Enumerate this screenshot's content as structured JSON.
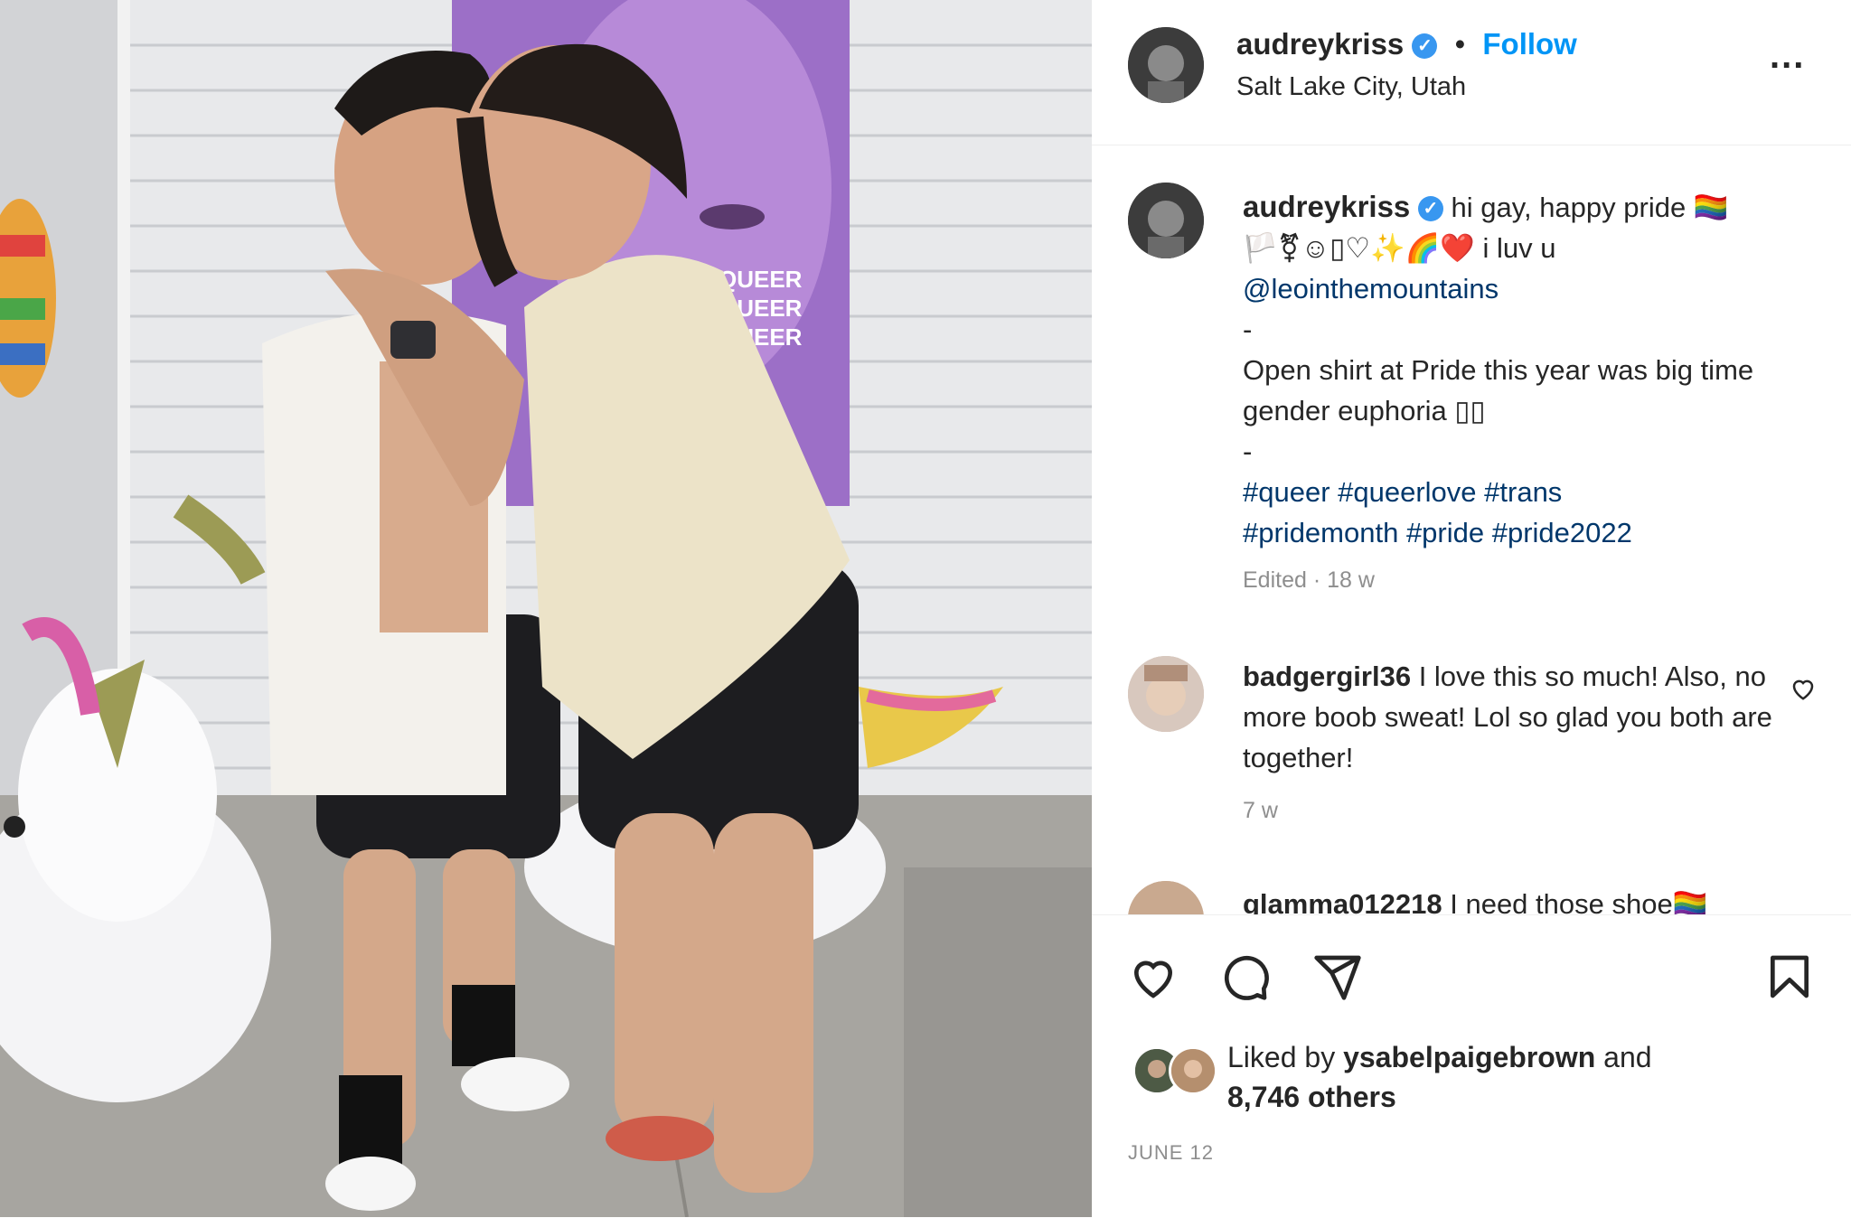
{
  "post": {
    "username": "audreykriss",
    "verified_glyph": "✓",
    "separator": "•",
    "follow_label": "Follow",
    "location": "Salt Lake City, Utah",
    "more_glyph": "..."
  },
  "photo": {
    "banner_text": [
      "QUEER",
      "QUEER",
      "QUEER"
    ]
  },
  "caption": {
    "username": "audreykriss",
    "text_first": "hi gay, happy pride 🏳️‍🌈",
    "emoji_line": "🏳️⚧☺▯♡✨🌈❤️ i luv u",
    "mention": "@leointhemountains",
    "dash1": "-",
    "body": "Open shirt at Pride this year was big time gender euphoria ▯▯",
    "dash2": "-",
    "hashtags_line1": "#queer #queerlove #trans",
    "hashtags_line2": "#pridemonth #pride #pride2022",
    "meta": "Edited · 18 w"
  },
  "comments": [
    {
      "username": "badgergirl36",
      "text": "I love this so much! Also, no more boob sweat! Lol so glad you both are together!",
      "age": "7 w"
    },
    {
      "username": "glamma012218",
      "text": "I need those shoe🏳️‍🌈"
    }
  ],
  "actions": {
    "icons": [
      "heart-icon",
      "comment-icon",
      "share-icon",
      "bookmark-icon"
    ]
  },
  "likes": {
    "prefix": "Liked by",
    "user": "ysabelpaigebrown",
    "and": "and",
    "others": "8,746 others"
  },
  "date": "JUNE 12",
  "colors": {
    "link_blue": "#0095f6",
    "hashtag_blue": "#00376b",
    "meta_gray": "#8e8e8e"
  }
}
